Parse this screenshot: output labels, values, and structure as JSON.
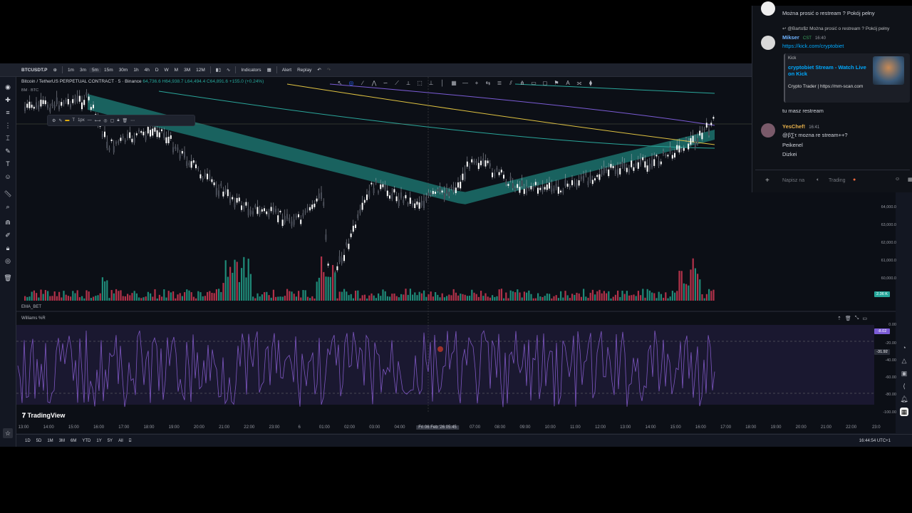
{
  "toolbar": {
    "symbol": "BTCUSDT.P",
    "intervals": [
      "1m",
      "3m",
      "5m",
      "15m",
      "30m",
      "1h",
      "4h",
      "D",
      "W",
      "M",
      "3M",
      "12M"
    ],
    "selected_interval": "5m",
    "indicators_label": "Indicators",
    "alert_label": "Alert",
    "replay_label": "Replay"
  },
  "legend": {
    "title": "Bitcoin / TetherUS PERPETUAL CONTRACT · 5 · Binance",
    "values": "64,736.6 H64,938.7 L64,494.4 C64,891.6 +155.0 (+0.24%)",
    "sub": "BM · BTC"
  },
  "float_toolbar": {
    "width_label": "1px"
  },
  "price_axis": {
    "labels": [
      "64,000.0",
      "63,000.0",
      "62,000.0",
      "61,000.0",
      "60,000.0"
    ],
    "badge": "2.36 K"
  },
  "panes": {
    "ema_label": "EMA_BET",
    "williams_label": "Williams %R",
    "wr_labels": [
      "0.00",
      "-20.00",
      "-40.00",
      "-60.00",
      "-80.00",
      "-100.00"
    ],
    "wr_badge1": "-8.02",
    "wr_badge2": "-31.92"
  },
  "time_axis": {
    "labels": [
      "13:00",
      "14:00",
      "15:00",
      "16:00",
      "17:00",
      "18:00",
      "19:00",
      "20:00",
      "21:00",
      "22:00",
      "23:00",
      "6",
      "01:00",
      "02:00",
      "03:00",
      "04:00",
      "07:00",
      "08:00",
      "09:00",
      "10:00",
      "11:00",
      "12:00",
      "13:00",
      "14:00",
      "15:00",
      "16:00",
      "17:00",
      "18:00",
      "19:00",
      "20:00",
      "21:00",
      "22:00",
      "23:0"
    ],
    "crosshair_label": "Fri 06 Feb '26",
    "crosshair_time": "05:45"
  },
  "bottom": {
    "ranges": [
      "1D",
      "5D",
      "1M",
      "3M",
      "6M",
      "YTD",
      "1Y",
      "5Y",
      "All"
    ],
    "clock": "16:44:54 UTC+1"
  },
  "brand": "TradingView",
  "chat": {
    "msg0": "Można prosić o restream ? Pokój pełny",
    "reply_ref": "@Barto$z Można prosić o restream ? Pokój pełny",
    "user1": {
      "name": "Mikser",
      "badge": "CST",
      "time": "16:40",
      "link": "https://kick.com/cryptobiet"
    },
    "card": {
      "source": "Kick",
      "title": "cryptobiet Stream - Watch Live on Kick",
      "desc": "Crypto Trader | https://mm-scan.com"
    },
    "msg_restream": "tu masz restream",
    "user2": {
      "name": "YesChef!",
      "time": "16:41",
      "lines": [
        "@β∑τ mozna re stream++?",
        "Peikenel",
        "Dizkei"
      ]
    },
    "input_placeholder": "Napisz na",
    "channel": "Trading"
  }
}
